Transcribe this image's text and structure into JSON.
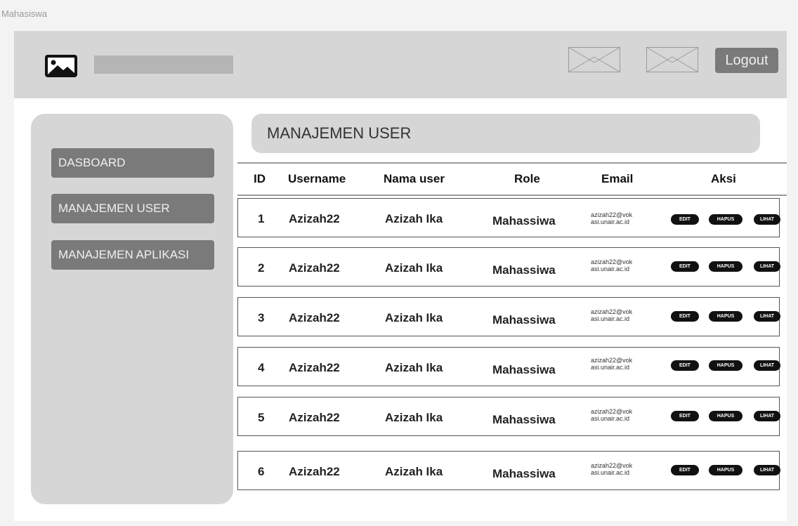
{
  "frame_title": "Mahasiswa",
  "header": {
    "logout_label": "Logout",
    "logo_icon": "image-icon",
    "placeholder_icons": [
      "image-placeholder-icon",
      "image-placeholder-icon"
    ]
  },
  "sidebar": {
    "items": [
      {
        "label": "DASBOARD"
      },
      {
        "label": "MANAJEMEN USER"
      },
      {
        "label": "MANAJEMEN APLIKASI"
      }
    ]
  },
  "page": {
    "title": "MANAJEMEN USER"
  },
  "table": {
    "columns": [
      "ID",
      "Username",
      "Nama user",
      "Role",
      "Email",
      "Aksi"
    ],
    "actions": [
      "EDIT",
      "HAPUS",
      "LIHAT"
    ],
    "rows": [
      {
        "id": "1",
        "username": "Azizah22",
        "nama": "Azizah Ika",
        "role": "Mahassiwa",
        "email_1": "azizah22@vok",
        "email_2": "asi.unair.ac.id"
      },
      {
        "id": "2",
        "username": "Azizah22",
        "nama": "Azizah Ika",
        "role": "Mahassiwa",
        "email_1": "azizah22@vok",
        "email_2": "asi.unair.ac.id"
      },
      {
        "id": "3",
        "username": "Azizah22",
        "nama": "Azizah Ika",
        "role": "Mahassiwa",
        "email_1": "azizah22@vok",
        "email_2": "asi.unair.ac.id"
      },
      {
        "id": "4",
        "username": "Azizah22",
        "nama": "Azizah Ika",
        "role": "Mahassiwa",
        "email_1": "azizah22@vok",
        "email_2": "asi.unair.ac.id"
      },
      {
        "id": "5",
        "username": "Azizah22",
        "nama": "Azizah Ika",
        "role": "Mahassiwa",
        "email_1": "azizah22@vok",
        "email_2": "asi.unair.ac.id"
      },
      {
        "id": "6",
        "username": "Azizah22",
        "nama": "Azizah Ika",
        "role": "Mahassiwa",
        "email_1": "azizah22@vok",
        "email_2": "asi.unair.ac.id"
      }
    ]
  }
}
